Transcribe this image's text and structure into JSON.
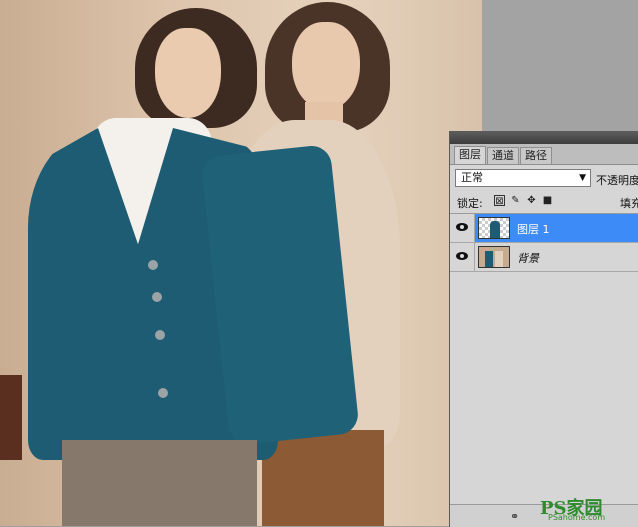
{
  "panel": {
    "tabs": [
      {
        "label": "图层",
        "active": true
      },
      {
        "label": "通道",
        "active": false
      },
      {
        "label": "路径",
        "active": false
      }
    ],
    "blend_mode": "正常",
    "opacity_label": "不透明度",
    "lock_label": "锁定:",
    "fill_label": "填充",
    "layers": [
      {
        "name": "图层 1",
        "selected": true,
        "visible": true
      },
      {
        "name": "背景",
        "selected": false,
        "visible": true
      }
    ],
    "lock_icons": [
      "lock-transparent-icon",
      "lock-brush-icon",
      "lock-move-icon",
      "lock-all-icon"
    ],
    "bottom_icons": [
      "link-icon"
    ]
  },
  "colors": {
    "selected_layer": "#3d8bf7",
    "panel_bg": "#d6d6d6",
    "cardigan_teal": "#1d5c72",
    "sweater_beige": "#e6d5c3"
  },
  "watermark": {
    "text": "PS家园",
    "sub": "PSahome.com"
  }
}
